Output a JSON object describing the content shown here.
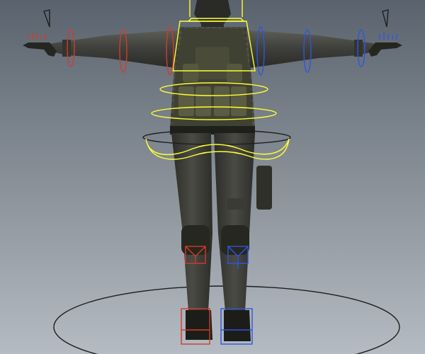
{
  "viewport": {
    "background_top": "#5a636d",
    "background_bottom": "#b5bbc2"
  },
  "colors": {
    "center_control": "#ffff33",
    "left_side_control": "#d23b2b",
    "right_side_control": "#2f55e0",
    "ground_circle": "#1e1e1e",
    "body_dark": "#2a2b27",
    "body_mid": "#4a4b44",
    "vest": "#3f4232",
    "pouch": "#5a5c43"
  },
  "scene": {
    "subject": "rigged-character-t-pose",
    "controls": [
      "hand-control-left",
      "hand-control-right",
      "arm-fk-controls",
      "chest-control",
      "hip-control",
      "root-control",
      "knee-pole-controls",
      "foot-ik-controls"
    ]
  }
}
